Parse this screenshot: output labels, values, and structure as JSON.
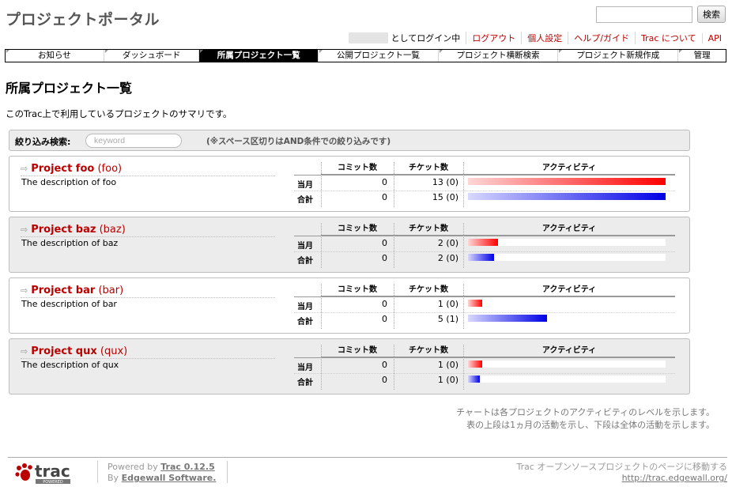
{
  "header": {
    "site_title": "プロジェクトポータル",
    "search_button": "検索",
    "search_value": ""
  },
  "metanav": {
    "logged_in": "としてログイン中",
    "logout": "ログアウト",
    "preferences": "個人設定",
    "help": "ヘルプ/ガイド",
    "about": "Trac について",
    "api": "API"
  },
  "mainnav": {
    "tabs": [
      {
        "label": "お知らせ"
      },
      {
        "label": "ダッシュボード"
      },
      {
        "label": "所属プロジェクト一覧"
      },
      {
        "label": "公開プロジェクト一覧"
      },
      {
        "label": "プロジェクト横断検索"
      },
      {
        "label": "プロジェクト新規作成"
      },
      {
        "label": "管理"
      }
    ],
    "active_index": 2
  },
  "main": {
    "heading": "所属プロジェクト一覧",
    "intro": "このTrac上で利用しているプロジェクトのサマリです。"
  },
  "filter": {
    "label": "絞り込み検索:",
    "placeholder": "keyword",
    "note": "(※スペース区切りはAND条件での絞り込みです)"
  },
  "table_headers": {
    "commits": "コミット数",
    "tickets": "チケット数",
    "activity": "アクティビティ",
    "row_month": "当月",
    "row_total": "合計"
  },
  "projects": [
    {
      "name": "Project foo",
      "id": "(foo)",
      "description": "The description of foo",
      "month": {
        "commits": "0",
        "tickets": "13 (0)",
        "activity": 1.0
      },
      "total": {
        "commits": "0",
        "tickets": "15 (0)",
        "activity": 1.0
      }
    },
    {
      "name": "Project baz",
      "id": "(baz)",
      "description": "The description of baz",
      "month": {
        "commits": "0",
        "tickets": "2 (0)",
        "activity": 0.15
      },
      "total": {
        "commits": "0",
        "tickets": "2 (0)",
        "activity": 0.13
      }
    },
    {
      "name": "Project bar",
      "id": "(bar)",
      "description": "The description of bar",
      "month": {
        "commits": "0",
        "tickets": "1 (0)",
        "activity": 0.07
      },
      "total": {
        "commits": "0",
        "tickets": "5 (1)",
        "activity": 0.4
      }
    },
    {
      "name": "Project qux",
      "id": "(qux)",
      "description": "The description of qux",
      "month": {
        "commits": "0",
        "tickets": "1 (0)",
        "activity": 0.07
      },
      "total": {
        "commits": "0",
        "tickets": "1 (0)",
        "activity": 0.06
      }
    }
  ],
  "chart_note": {
    "line1": "チャートは各プロジェクトのアクティビティのレベルを示します。",
    "line2": "表の上段は1ヵ月の活動を示し、下段は全体の活動を示します。"
  },
  "footer": {
    "powered_prefix": "Powered by",
    "trac_version": "Trac 0.12.5",
    "by_prefix": "By",
    "by_link": "Edgewall Software.",
    "right_line1": "Trac オープンソースプロジェクトのページに移動する",
    "right_link": "http://trac.edgewall.org/",
    "logo_text": "trac",
    "logo_sub": "POWERED"
  },
  "colors": {
    "month_bar": "#ff0000",
    "total_bar": "#0000e6",
    "link": "#bb0000"
  }
}
